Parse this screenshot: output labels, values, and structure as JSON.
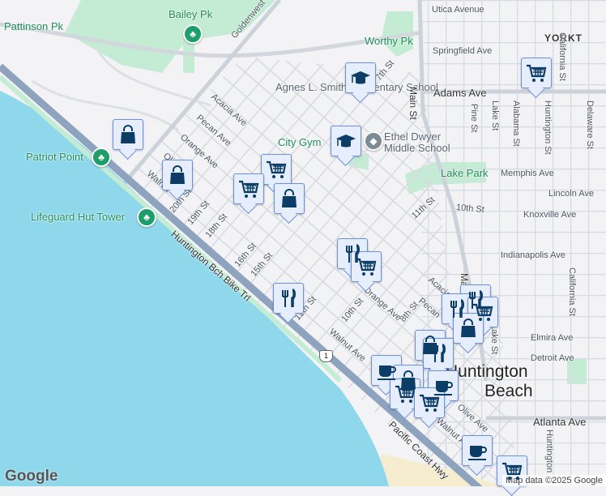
{
  "map": {
    "colors": {
      "water": "#8fd8ec",
      "land": "#f3f2f4",
      "park": "#c4ecd4",
      "road": "#d5dae1",
      "highway": "#8ea3bd",
      "beach": "#f6ecd0",
      "marker_fill": "#e6edfc",
      "marker_border": "#6d92dc",
      "icon": "#0b3d66"
    },
    "city_label": [
      "Huntington",
      "Beach"
    ],
    "district_label": "YORKT",
    "parks": [
      "Bailey Pk",
      "Pattinson Pk",
      "Worthy Pk",
      "Patriot Point",
      "Lifeguard Hut Tower",
      "City Gym",
      "Lake Park"
    ],
    "schools": [
      "Agnes L. Smith Elementary School",
      "Ethel Dwyer Middle School"
    ],
    "streets": {
      "goldenwest": "Goldenwest St",
      "acacia": "Acacia Ave",
      "pecan": "Pecan Ave",
      "orange": "Orange Ave",
      "olive": "Olive",
      "walnut": "Walnut",
      "s20": "20th St",
      "s19": "19th St",
      "s18": "18th St",
      "s16": "16th St",
      "s15": "15th St",
      "s12": "12th St",
      "s10": "10th St",
      "s8": "8th St",
      "s11": "11th St",
      "s10b": "10th St",
      "s7": "7th St",
      "bike": "Huntington Bch Bike Trl",
      "pch": "Pacific Coast Hwy",
      "route": "1",
      "main": "Main St",
      "utica": "Utica Avenue",
      "springfield": "Springfield Ave",
      "adams": "Adams Ave",
      "pine": "Pine St",
      "lake": "Lake St",
      "alabama": "Alabama St",
      "huntington": "Huntington St",
      "california": "California St",
      "delaware": "Delaware St",
      "memphis": "Memphis Ave",
      "lincoln": "Lincoln Ave",
      "knoxville": "Knoxville Ave",
      "indianapolis": "Indianapolis Ave",
      "elmira": "Elmira Ave",
      "detroit": "Detroit Ave",
      "atlanta": "Atlanta Ave",
      "orange2": "Orange Ave",
      "walnut2": "Walnut Ave",
      "olive2": "Olive Ave",
      "walnut3": "Walnut Ave",
      "acacia2": "Acacia",
      "pecan2": "Pecan",
      "lake2": "Lake St",
      "huntington2": "Huntington",
      "california2": "California St",
      "main2": "Main"
    },
    "markers": [
      "shopping-bag",
      "shopping-bag",
      "shopping-cart",
      "shopping-cart",
      "shopping-bag",
      "school",
      "school",
      "shopping-cart",
      "restaurant",
      "shopping-cart",
      "restaurant",
      "restaurant",
      "restaurant",
      "shopping-cart",
      "shopping-bag",
      "shopping-bag",
      "restaurant",
      "coffee",
      "shopping-bag",
      "coffee",
      "shopping-cart",
      "shopping-cart",
      "coffee",
      "shopping-cart"
    ],
    "attribution": "Map data ©2025 Google",
    "logo": "Google"
  }
}
